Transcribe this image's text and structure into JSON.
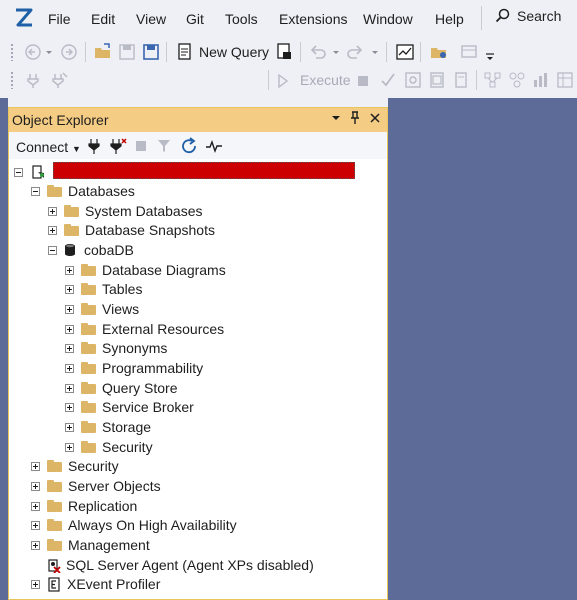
{
  "menu": {
    "items": [
      "File",
      "Edit",
      "View",
      "Git",
      "Tools",
      "Extensions",
      "Window",
      "Help"
    ],
    "search_label": "Search"
  },
  "toolbar": {
    "new_query_label": "New Query",
    "execute_label": "Execute",
    "database_combo_value": ""
  },
  "object_explorer": {
    "title": "Object Explorer",
    "connect_label": "Connect",
    "server_name": "",
    "tree": [
      {
        "label": "Databases"
      },
      {
        "label": "System Databases"
      },
      {
        "label": "Database Snapshots"
      },
      {
        "label": "cobaDB"
      },
      {
        "label": "Database Diagrams"
      },
      {
        "label": "Tables"
      },
      {
        "label": "Views"
      },
      {
        "label": "External Resources"
      },
      {
        "label": "Synonyms"
      },
      {
        "label": "Programmability"
      },
      {
        "label": "Query Store"
      },
      {
        "label": "Service Broker"
      },
      {
        "label": "Storage"
      },
      {
        "label": "Security"
      },
      {
        "label": "Security"
      },
      {
        "label": "Server Objects"
      },
      {
        "label": "Replication"
      },
      {
        "label": "Always On High Availability"
      },
      {
        "label": "Management"
      },
      {
        "label": "SQL Server Agent (Agent XPs disabled)"
      },
      {
        "label": "XEvent Profiler"
      }
    ]
  },
  "colors": {
    "accent_title": "#f5cc84",
    "doc_background": "#5d6b99",
    "folder": "#dcb567",
    "redaction": "#cc0000"
  }
}
